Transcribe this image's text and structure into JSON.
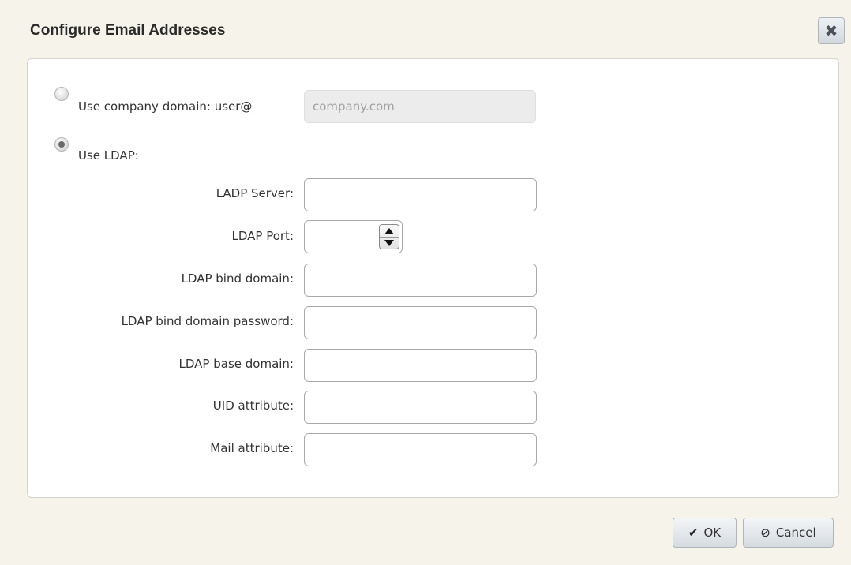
{
  "dialog": {
    "title": "Configure Email Addresses",
    "close_icon": "close-icon"
  },
  "options": {
    "company_domain": {
      "label": "Use company domain: user@",
      "placeholder": "company.com",
      "selected": false
    },
    "ldap": {
      "label": "Use LDAP:",
      "selected": true
    }
  },
  "ldap_fields": {
    "server_label": "LADP Server:",
    "port_label": "LDAP Port:",
    "bind_domain_label": "LDAP bind domain:",
    "bind_password_label": "LDAP bind domain password:",
    "base_domain_label": "LDAP base domain:",
    "uid_label": "UID attribute:",
    "mail_label": "Mail attribute:"
  },
  "buttons": {
    "ok_label": "OK",
    "ok_icon": "checkmark-icon",
    "cancel_label": "Cancel",
    "cancel_icon": "cancel-circle-icon"
  }
}
